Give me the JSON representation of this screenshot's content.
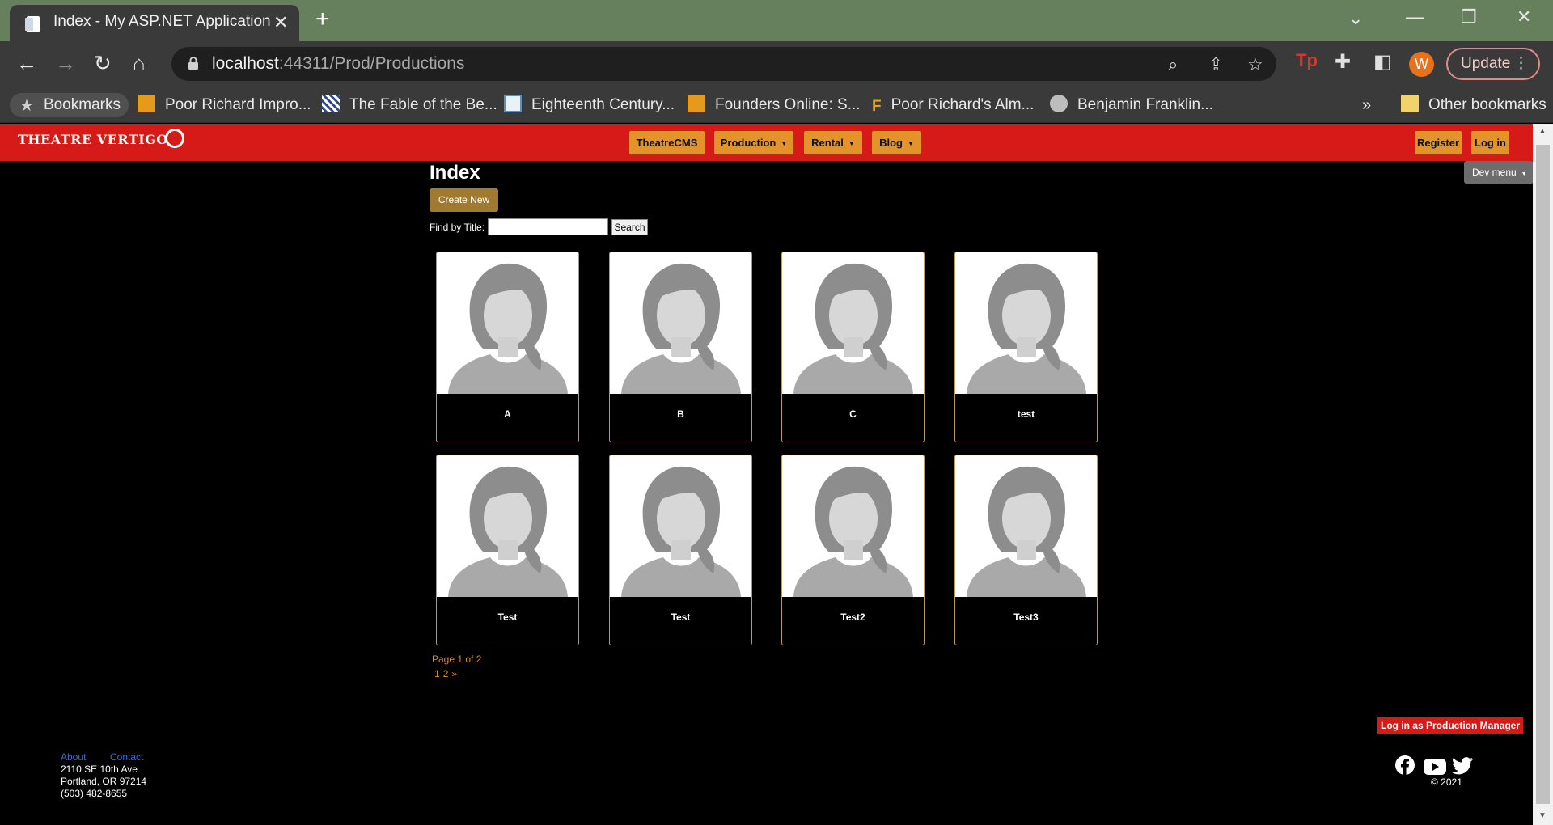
{
  "browser": {
    "tab_title": "Index - My ASP.NET Application",
    "tab_close": "✕",
    "new_tab": "+",
    "url_host": "localhost",
    "url_rest": ":44311/Prod/Productions",
    "update_label": "Update",
    "profile_initial": "W",
    "bookmarks": [
      {
        "label": "Bookmarks"
      },
      {
        "label": "Poor Richard Impro..."
      },
      {
        "label": "The Fable of the Be..."
      },
      {
        "label": "Eighteenth Century..."
      },
      {
        "label": "Founders Online: S..."
      },
      {
        "label": "Poor Richard's Alm..."
      },
      {
        "label": "Benjamin Franklin..."
      }
    ],
    "overflow": "»",
    "other_bookmarks": "Other bookmarks"
  },
  "site": {
    "logo": "THEATRE VERTIGO",
    "nav": {
      "theatrecms": "TheatreCMS",
      "production": "Production",
      "rental": "Rental",
      "blog": "Blog",
      "register": "Register",
      "login": "Log in"
    },
    "dev_menu": "Dev menu"
  },
  "main": {
    "title": "Index",
    "create_new": "Create New",
    "find_label": "Find by Title:",
    "find_value": "",
    "search_button": "Search",
    "productions": [
      {
        "title": "A"
      },
      {
        "title": "B"
      },
      {
        "title": "C"
      },
      {
        "title": "test"
      },
      {
        "title": "Test"
      },
      {
        "title": "Test"
      },
      {
        "title": "Test2"
      },
      {
        "title": "Test3"
      }
    ],
    "page_info": "Page 1 of 2",
    "pager": {
      "p1": "1",
      "p2": "2",
      "next": "»"
    }
  },
  "footer": {
    "pm_login": "Log in as Production Manager",
    "about": "About",
    "contact": "Contact",
    "address1": "2110 SE 10th Ave",
    "address2": "Portland, OR 97214",
    "phone": "(503) 482-8655",
    "copyright": "© 2021"
  },
  "colors": {
    "nav_red": "#d61a17",
    "nav_button": "#e4922a",
    "card_border": "#b89a5a",
    "link_orange": "#d68a2e"
  }
}
